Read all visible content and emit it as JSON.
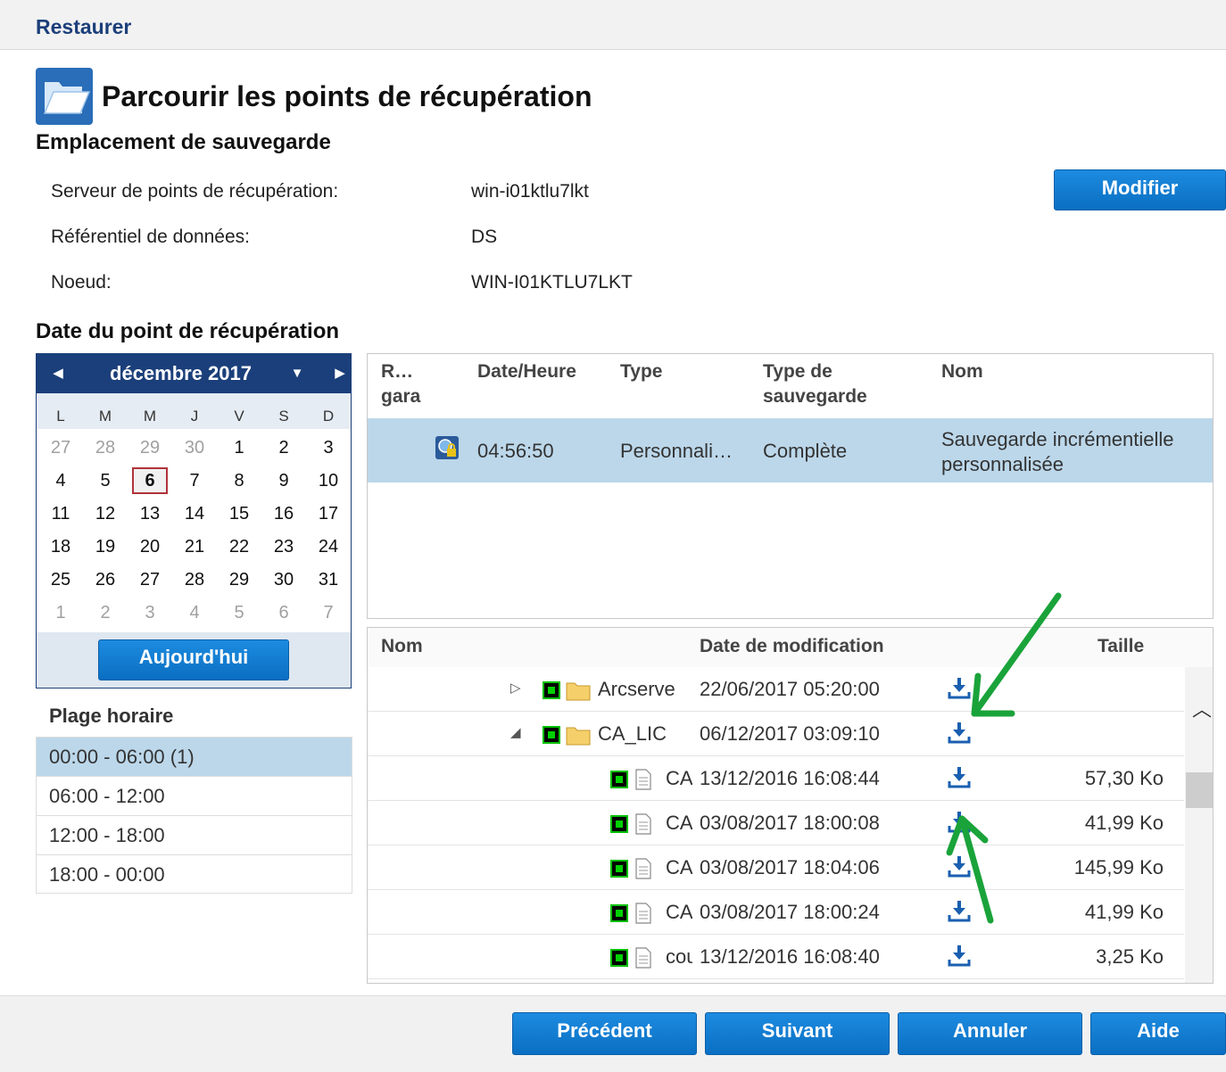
{
  "window": {
    "title": "Restaurer"
  },
  "page": {
    "title": "Parcourir les points de récupération"
  },
  "backup_location": {
    "section_title": "Emplacement de sauvegarde",
    "rows": [
      {
        "label": "Serveur de points de récupération:",
        "value": "win-i01ktlu7lkt"
      },
      {
        "label": "Référentiel de données:",
        "value": "DS"
      },
      {
        "label": "Noeud:",
        "value": "WIN-I01KTLU7LKT"
      }
    ],
    "modify_label": "Modifier"
  },
  "date_section": {
    "title": "Date du point de récupération"
  },
  "calendar": {
    "month": "décembre 2017",
    "weekdays": [
      "L",
      "M",
      "M",
      "J",
      "V",
      "S",
      "D"
    ],
    "weeks": [
      [
        "27",
        "28",
        "29",
        "30",
        "1",
        "2",
        "3"
      ],
      [
        "4",
        "5",
        "6",
        "7",
        "8",
        "9",
        "10"
      ],
      [
        "11",
        "12",
        "13",
        "14",
        "15",
        "16",
        "17"
      ],
      [
        "18",
        "19",
        "20",
        "21",
        "22",
        "23",
        "24"
      ],
      [
        "25",
        "26",
        "27",
        "28",
        "29",
        "30",
        "31"
      ],
      [
        "1",
        "2",
        "3",
        "4",
        "5",
        "6",
        "7"
      ]
    ],
    "selected_day": "6",
    "today_label": "Aujourd'hui"
  },
  "time_range": {
    "title": "Plage horaire",
    "items": [
      "00:00 - 06:00   (1)",
      "06:00 - 12:00",
      "12:00 - 18:00",
      "18:00 - 00:00"
    ]
  },
  "recovery_points": {
    "headers": {
      "col1_line1": "R…",
      "col1_line2": "gara",
      "datetime": "Date/Heure",
      "type": "Type",
      "backup_type_line1": "Type de",
      "backup_type_line2": "sauvegarde",
      "name": "Nom"
    },
    "rows": [
      {
        "time": "04:56:50",
        "type": "Personnali…",
        "backup_type": "Complète",
        "name_line1": "Sauvegarde incrémentielle",
        "name_line2": "personnalisée"
      }
    ]
  },
  "files": {
    "headers": {
      "name": "Nom",
      "modified": "Date de modification",
      "size": "Taille"
    },
    "rows": [
      {
        "name": "Arcserve",
        "date": "22/06/2017 05:20:00",
        "size": ""
      },
      {
        "name": "CA_LIC",
        "date": "06/12/2017 03:09:10",
        "size": ""
      },
      {
        "name": "CA Li",
        "date": "13/12/2016 16:08:44",
        "size": "57,30 Ko"
      },
      {
        "name": "CALi",
        "date": "03/08/2017 18:00:08",
        "size": "41,99 Ko"
      },
      {
        "name": "CAmi",
        "date": "03/08/2017 18:04:06",
        "size": "145,99 Ko"
      },
      {
        "name": "CAre",
        "date": "03/08/2017 18:00:24",
        "size": "41,99 Ko"
      },
      {
        "name": "count",
        "date": "13/12/2016 16:08:40",
        "size": "3,25 Ko"
      }
    ]
  },
  "footer": {
    "prev": "Précédent",
    "next": "Suivant",
    "cancel": "Annuler",
    "help": "Aide"
  },
  "colors": {
    "accent": "#0a6fc2",
    "header_dark": "#1b3f7a",
    "selection": "#bcd7ea",
    "annotation": "#1aa33a"
  }
}
